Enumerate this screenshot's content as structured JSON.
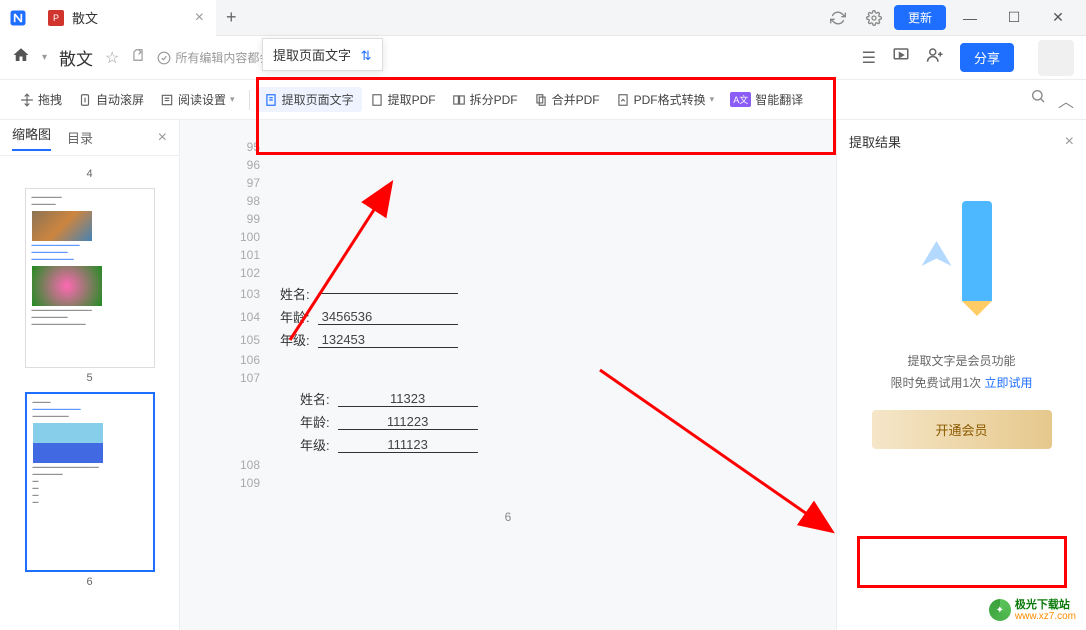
{
  "titlebar": {
    "tab_title": "散文",
    "update_btn": "更新"
  },
  "header": {
    "doc_title": "散文",
    "cloud_status": "所有编辑内容都会自动保存到云端",
    "share_btn": "分享"
  },
  "toolbar": {
    "drag": "拖拽",
    "autoscroll": "自动滚屏",
    "read_settings": "阅读设置",
    "extract_text": "提取页面文字",
    "extract_pdf": "提取PDF",
    "split_pdf": "拆分PDF",
    "merge_pdf": "合并PDF",
    "convert_pdf": "PDF格式转换",
    "smart_translate": "智能翻译"
  },
  "dropdown": {
    "item1": "提取页面文字"
  },
  "sidebar": {
    "thumbnails": "缩略图",
    "catalog": "目录",
    "page_4": "4",
    "page_5": "5",
    "page_6": "6"
  },
  "content": {
    "lines": [
      "95",
      "96",
      "97",
      "98",
      "99",
      "100",
      "101",
      "102",
      "103",
      "104",
      "105",
      "106",
      "107",
      "",
      "",
      "",
      "108",
      "109"
    ],
    "row103_label": "姓名:",
    "row103_val": "",
    "row104_label": "年龄:",
    "row104_val": "3456536",
    "row105_label": "年级:",
    "row105_val": "132453",
    "sub_name_label": "姓名:",
    "sub_name_val": "11323",
    "sub_age_label": "年龄:",
    "sub_age_val": "111223",
    "sub_grade_label": "年级:",
    "sub_grade_val": "111123",
    "page_num": "6"
  },
  "rightpanel": {
    "title": "提取结果",
    "msg1": "提取文字是会员功能",
    "msg2": "限时免费试用1次",
    "try_link": "立即试用",
    "vip_btn": "开通会员"
  },
  "watermark": {
    "cn": "极光下载站",
    "url": "www.xz7.com"
  }
}
